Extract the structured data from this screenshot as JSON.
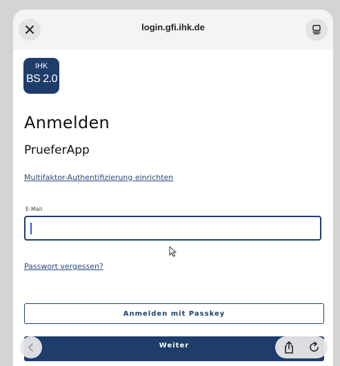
{
  "browser": {
    "url": "login.gfi.ihk.de",
    "icons": [
      "close-icon",
      "reader-icon",
      "back-icon",
      "share-icon",
      "reload-icon"
    ]
  },
  "logo": {
    "line1": "IHK",
    "line2": "BS 2.0"
  },
  "page": {
    "title": "Anmelden",
    "subtitle": "PrueferApp",
    "mfa_link": "Multifaktor-Authentifizierung einrichten",
    "email_label": "E-Mail",
    "email_value": "",
    "forgot_link": "Passwort vergessen?",
    "passkey_button": "Anmelden mit Passkey",
    "next_button": "Weiter"
  },
  "colors": {
    "brand": "#1f3d6a",
    "link": "#2a4a7a",
    "caret": "#2a58c9"
  }
}
